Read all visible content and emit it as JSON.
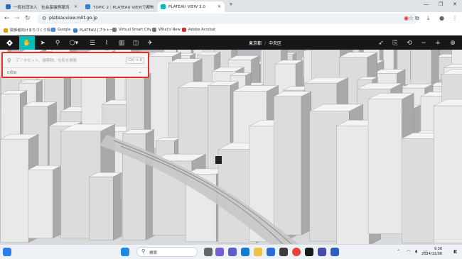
{
  "browser": {
    "tabs": [
      {
        "label": "一般社団法人　社会基盤情報流"
      },
      {
        "label": "TOPIC 2｜PLATEAU VIEWで都市"
      },
      {
        "label": "PLATEAU VIEW 3.0"
      }
    ],
    "url": "plateauview.mlit.go.jp",
    "bookmarks": [
      {
        "label": "関係者向けまちづくり情報"
      },
      {
        "label": "Google"
      },
      {
        "label": "PLATEAU [プラトー]"
      },
      {
        "label": "Virtual Smart City"
      },
      {
        "label": "What's New"
      },
      {
        "label": "Adobe Acrobat"
      }
    ]
  },
  "app": {
    "location": {
      "prefecture": "東京都",
      "ward": "中央区"
    },
    "search": {
      "placeholder": "データセット、建築物、住所を検索",
      "value": "",
      "shortcut": "Ctrl + K",
      "count_label": "0項目"
    }
  },
  "taskbar": {
    "search_label": "検索",
    "time": "9:36",
    "date": "2024/11/08"
  },
  "colors": {
    "accent": "#00bebe",
    "highlight": "#e0312b"
  }
}
